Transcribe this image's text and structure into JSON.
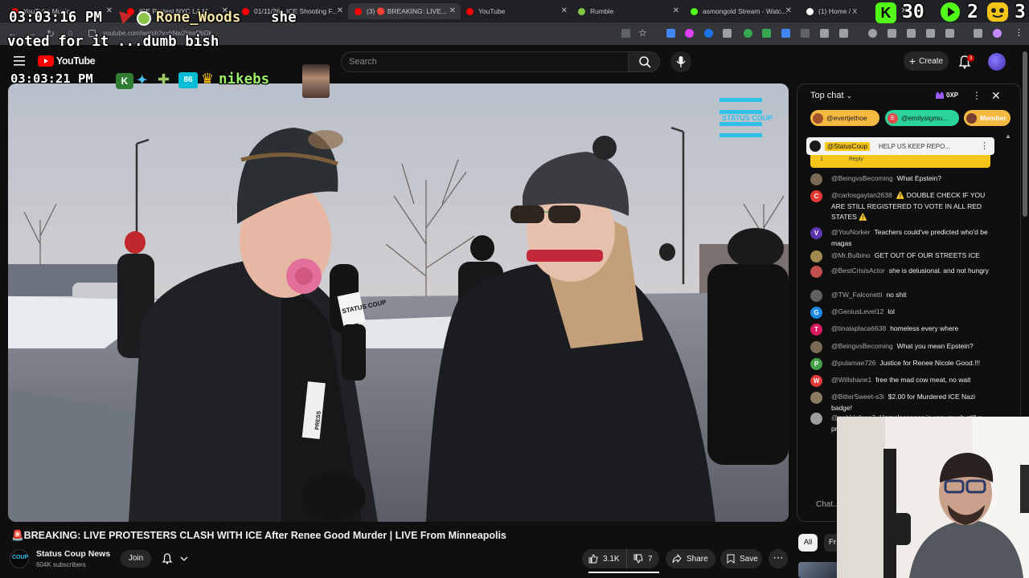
{
  "browser": {
    "tabs": [
      {
        "label": "YouTube Music",
        "color": "#ff0000"
      },
      {
        "label": "ICE Protest NYC LA M...",
        "color": "#ff0000"
      },
      {
        "label": "01/11/26 - ICE Shooting F...",
        "color": "#ff0000"
      },
      {
        "label": "(3) 🔴 BREAKING: LIVE...",
        "color": "#ff0000",
        "active": true
      },
      {
        "label": "YouTube",
        "color": "#ff0000"
      },
      {
        "label": "Rumble",
        "color": "#85c742"
      },
      {
        "label": "asmongold Stream - Watc...",
        "color": "#53fc18"
      },
      {
        "label": "(1) Home / X",
        "color": "#ffffff"
      }
    ],
    "url": "youtube.com/watch?v=hNw2hkeDbDk"
  },
  "overlay": {
    "timestamp1": "03:03:16 PM",
    "user1": "Rone_Woods",
    "msg1a": "she",
    "msg1b": "voted for it ...dumb bish",
    "timestamp2": "03:03:21 PM",
    "user2": "nikebs",
    "counters": [
      {
        "value": "30",
        "color": "#53fc18"
      },
      {
        "value": "2",
        "color": "#53fc18"
      },
      {
        "value": "3",
        "color": "#f5c518"
      }
    ]
  },
  "youtube": {
    "logo_text": "YouTube",
    "search_placeholder": "Search",
    "create_label": "Create",
    "notif_count": "3"
  },
  "video": {
    "title": "🚨BREAKING: LIVE PROTESTERS CLASH WITH ICE After Renee Good Murder | LIVE From Minneapolis",
    "watermark": "STATUS COUP",
    "mic_flag": "STATUS COUP",
    "press_badge": "PRESS"
  },
  "channel": {
    "name": "Status Coup News",
    "subscribers": "604K subscribers",
    "join_label": "Join",
    "logo_text": "COUP"
  },
  "actions": {
    "likes": "3.1K",
    "dislikes": "7",
    "share": "Share",
    "save": "Save"
  },
  "chat": {
    "header": "Top chat",
    "xp": "0XP",
    "chips": [
      {
        "label": "@evertjethoe",
        "color": "#f5b942"
      },
      {
        "label": "@emilysigmu...",
        "color": "#29d39a"
      },
      {
        "label": "Member",
        "color": "#f5b942"
      }
    ],
    "pinned": {
      "author": "@StatusCoup",
      "text": "HELP US KEEP REPO...",
      "reply": "Reply",
      "count": "1"
    },
    "messages": [
      {
        "author": "@BeingvsBecoming",
        "text": "What Epstein?",
        "avatar": "",
        "color": "#7a6a55"
      },
      {
        "author": "@carlosgaytan2638",
        "text": "⚠️ DOUBLE CHECK IF YOU ARE STILL REGISTERED TO VOTE IN ALL RED STATES ⚠️",
        "avatar": "C",
        "color": "#e53935"
      },
      {
        "author": "@YouNorker",
        "text": "Teachers could've predicted who'd be magas",
        "avatar": "V",
        "color": "#5e35b1"
      },
      {
        "author": "@Mr.Bulbino",
        "text": "GET OUT OF OUR STREETS ICE",
        "avatar": "",
        "color": "#a08a50"
      },
      {
        "author": "@BestCrisisActor",
        "text": "she is delusional. and not hungry",
        "avatar": "",
        "color": "#c0504d"
      },
      {
        "author": "@TW_Falconetti",
        "text": "no shit",
        "avatar": "",
        "color": "#606060"
      },
      {
        "author": "@GeniusLevel12",
        "text": "lol",
        "avatar": "G",
        "color": "#1e88e5"
      },
      {
        "author": "@tinalaplaca6638",
        "text": "homeless every where",
        "avatar": "T",
        "color": "#d81b60"
      },
      {
        "author": "@BeingvsBecoming",
        "text": "What you mean Epstein?",
        "avatar": "",
        "color": "#7a6a55"
      },
      {
        "author": "@pulamae726",
        "text": "Justice for Renee Nicole Good.!!!",
        "avatar": "P",
        "color": "#43a047"
      },
      {
        "author": "@Willshane1",
        "text": "free the mad cow meat, no wait",
        "avatar": "W",
        "color": "#e53935"
      },
      {
        "author": "@BitterSweet-s3i",
        "text": "$2.00 for Murdered ICE Nazi badge!",
        "avatar": "",
        "color": "#8a7a60"
      },
      {
        "author": "@pebbleface7",
        "text": "Homelessness is very much still a pr...",
        "avatar": "",
        "color": "#9e9e9e"
      }
    ],
    "input_placeholder": "Chat...",
    "filter_all": "All",
    "filter_friends": "Fr"
  }
}
